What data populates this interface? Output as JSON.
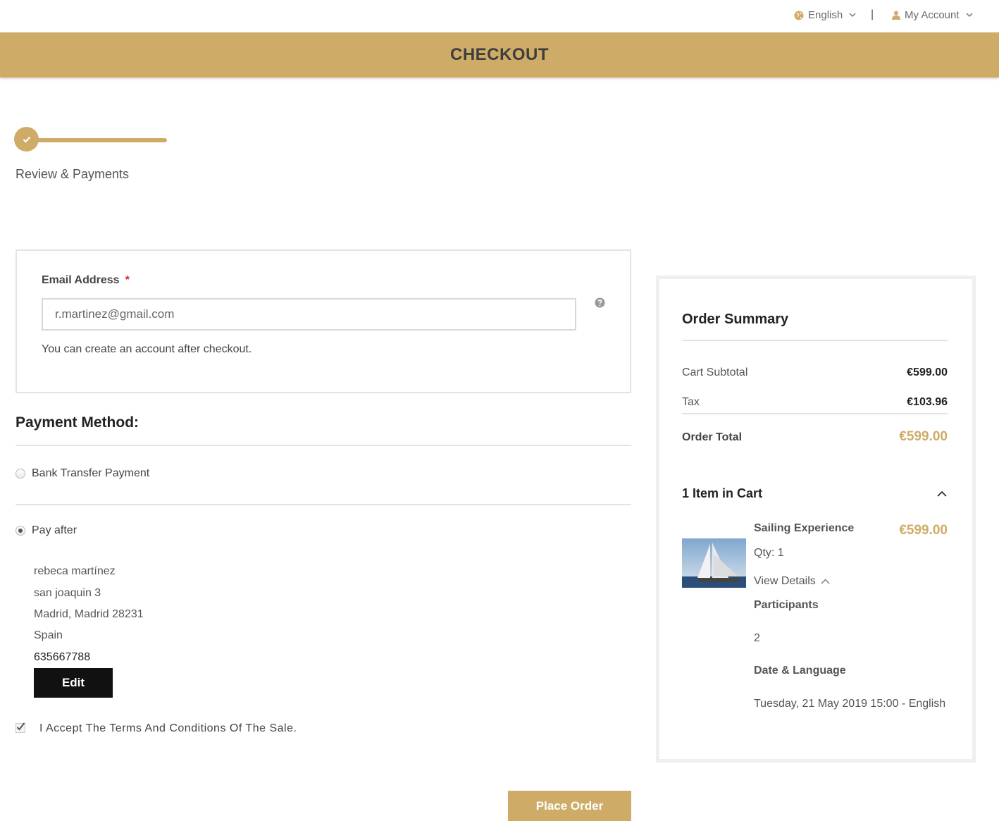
{
  "topbar": {
    "language_label": "English",
    "separator": "|",
    "account_label": "My Account"
  },
  "header": {
    "title": "CHECKOUT"
  },
  "progress": {
    "step_label": "Review & Payments"
  },
  "email": {
    "label": "Email Address",
    "required_mark": "*",
    "value": "r.martinez@gmail.com",
    "note": "You can create an account after checkout."
  },
  "payment": {
    "title": "Payment Method:",
    "options": [
      {
        "label": "Bank Transfer Payment",
        "selected": false
      },
      {
        "label": "Pay after",
        "selected": true
      }
    ],
    "address": {
      "name": "rebeca martínez",
      "street": "san joaquin 3",
      "city_line": "Madrid, Madrid 28231",
      "country": "Spain",
      "phone": "635667788"
    },
    "edit_label": "Edit",
    "terms_label": "I Accept The Terms And Conditions Of The Sale.",
    "terms_checked": true,
    "place_order_label": "Place Order"
  },
  "summary": {
    "title": "Order Summary",
    "subtotal_label": "Cart Subtotal",
    "subtotal_value": "€599.00",
    "tax_label": "Tax",
    "tax_value": "€103.96",
    "total_label": "Order Total",
    "total_value": "€599.00",
    "cart_title": "1 Item in Cart",
    "item": {
      "name": "Sailing Experience",
      "price": "€599.00",
      "qty": "Qty: 1",
      "view_details": "View Details",
      "options": [
        {
          "label": "Participants",
          "value": "2"
        },
        {
          "label": "Date & Language",
          "value": "Tuesday, 21 May 2019 15:00 - English"
        }
      ]
    }
  },
  "colors": {
    "accent": "#ceac67",
    "header_text": "#3e3e3e",
    "required": "#e02b27"
  }
}
